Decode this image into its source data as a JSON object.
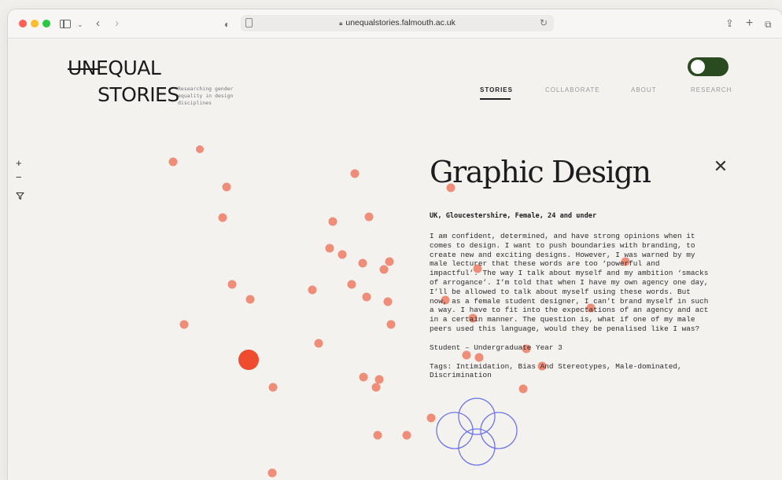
{
  "browser": {
    "url": "unequalstories.falmouth.ac.uk"
  },
  "site": {
    "logo_line1": "UNEQUAL",
    "logo_line2": "STORIES",
    "tagline": "Researching gender equality in design disciplines",
    "nav": [
      {
        "label": "STORIES",
        "active": true
      },
      {
        "label": "COLLABORATE",
        "active": false
      },
      {
        "label": "ABOUT",
        "active": false
      },
      {
        "label": "RESEARCH",
        "active": false
      }
    ],
    "toggle_color": "#2a4a1f"
  },
  "controls": {
    "zoom_in": "+",
    "zoom_out": "−"
  },
  "story": {
    "title": "Graphic Design",
    "meta": "UK, Gloucestershire, Female, 24 and under",
    "body": "I am confident, determined, and have strong opinions when it comes to design. I want to push boundaries with branding, to create new and exciting designs. However, I was warned by my male lecturer that these words are too ‘powerful and impactful’. The way I talk about myself and my ambition ‘smacks of arrogance’. I’m told that when I have my own agency one day, I’ll be allowed to talk about myself using these words. But now, as a female student designer, I can’t brand myself in such a way. I have to fit into the expectations of an agency and act in a certain manner. The question is, what if one of my male peers used this language, would they be penalised like I was?",
    "level": "Student – Undergraduate Year 3",
    "tags": "Tags: Intimidation, Bias And Stereotypes, Male-dominated, Discrimination"
  },
  "colors": {
    "dot": "#f0826a",
    "dot_selected": "#ef4b2f",
    "ring": "#6d74f0"
  }
}
